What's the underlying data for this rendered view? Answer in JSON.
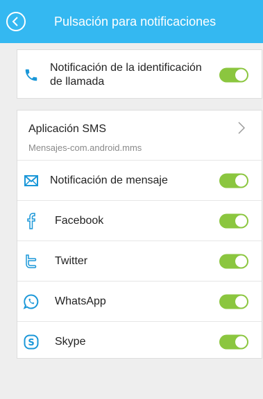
{
  "header": {
    "title": "Pulsación para notificaciones",
    "back_icon": "back-arrow-circle-icon",
    "background": "#34b8f1"
  },
  "caller_id": {
    "label": "Notificación de la identificación de llamada",
    "icon": "phone-icon",
    "enabled": true
  },
  "sms": {
    "title": "Aplicación SMS",
    "subtitle": "Mensajes-com.android.mms",
    "icon": "chevron-right-icon"
  },
  "notifications": [
    {
      "label": "Notificación de mensaje",
      "icon": "envelope-icon",
      "enabled": true
    },
    {
      "label": "Facebook",
      "icon": "facebook-icon",
      "enabled": true
    },
    {
      "label": "Twitter",
      "icon": "twitter-icon",
      "enabled": true
    },
    {
      "label": "WhatsApp",
      "icon": "whatsapp-icon",
      "enabled": true
    },
    {
      "label": "Skype",
      "icon": "skype-icon",
      "enabled": true
    }
  ],
  "colors": {
    "accent": "#1a97d8",
    "toggle_on": "#8bc63f"
  }
}
